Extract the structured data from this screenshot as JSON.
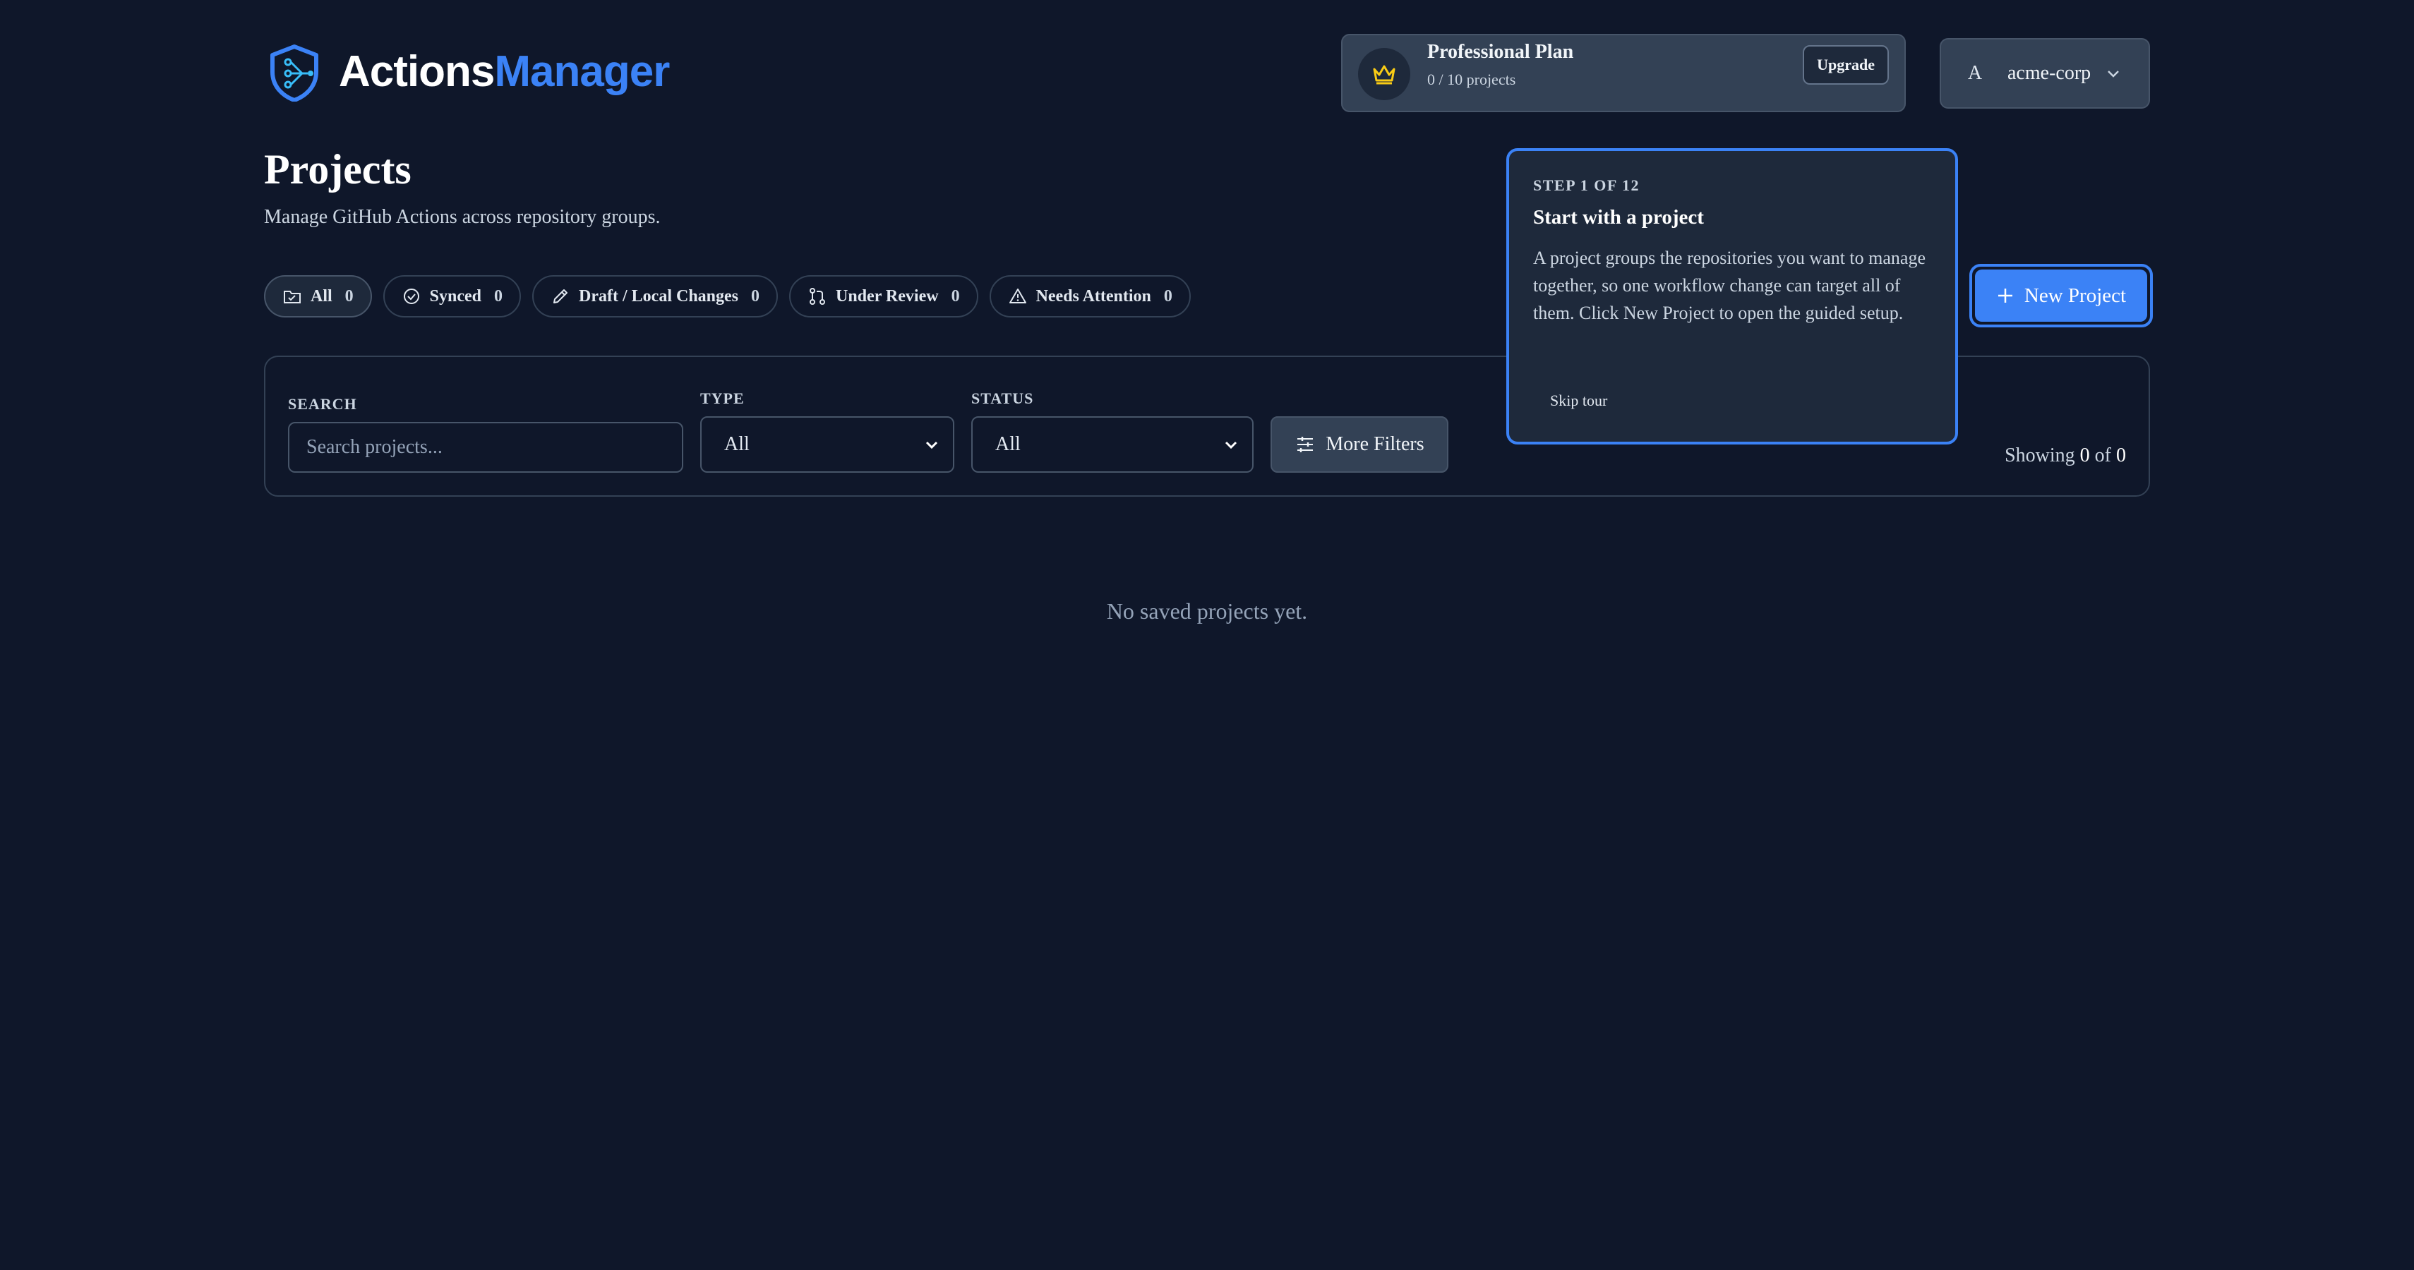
{
  "header": {
    "logo_primary": "Actions",
    "logo_accent": "Manager",
    "logo_icon": "shield-branch-icon"
  },
  "plan": {
    "title": "Professional Plan",
    "usage": "0 / 10 projects",
    "upgrade_label": "Upgrade",
    "icon": "crown-icon"
  },
  "org": {
    "avatar_letter": "A",
    "name": "acme-corp"
  },
  "page": {
    "title": "Projects",
    "subtitle": "Manage GitHub Actions across repository groups."
  },
  "tabs": [
    {
      "label": "All",
      "count": "0",
      "icon": "folder-icon",
      "active": true
    },
    {
      "label": "Synced",
      "count": "0",
      "icon": "check-circle-icon"
    },
    {
      "label": "Draft / Local Changes",
      "count": "0",
      "icon": "pencil-icon"
    },
    {
      "label": "Under Review",
      "count": "0",
      "icon": "pull-request-icon"
    },
    {
      "label": "Needs Attention",
      "count": "0",
      "icon": "warning-icon"
    }
  ],
  "new_project_label": "New Project",
  "filters": {
    "search_label": "SEARCH",
    "search_placeholder": "Search projects...",
    "search_value": "",
    "type_label": "TYPE",
    "type_value": "All",
    "status_label": "STATUS",
    "status_value": "All",
    "more_filters_label": "More Filters",
    "showing_prefix": "Showing",
    "showing_count": "0",
    "showing_of": "of",
    "showing_total": "0"
  },
  "empty_state": "No saved projects yet.",
  "tour": {
    "step": "STEP 1 OF 12",
    "title": "Start with a project",
    "body": "A project groups the repositories you want to manage together, so one workflow change can target all of them. Click New Project to open the guided setup.",
    "skip_label": "Skip tour"
  },
  "colors": {
    "background": "#0f172a",
    "accent": "#3b82f6",
    "surface": "#1e293b",
    "border": "#334155",
    "crown": "#facc15"
  }
}
